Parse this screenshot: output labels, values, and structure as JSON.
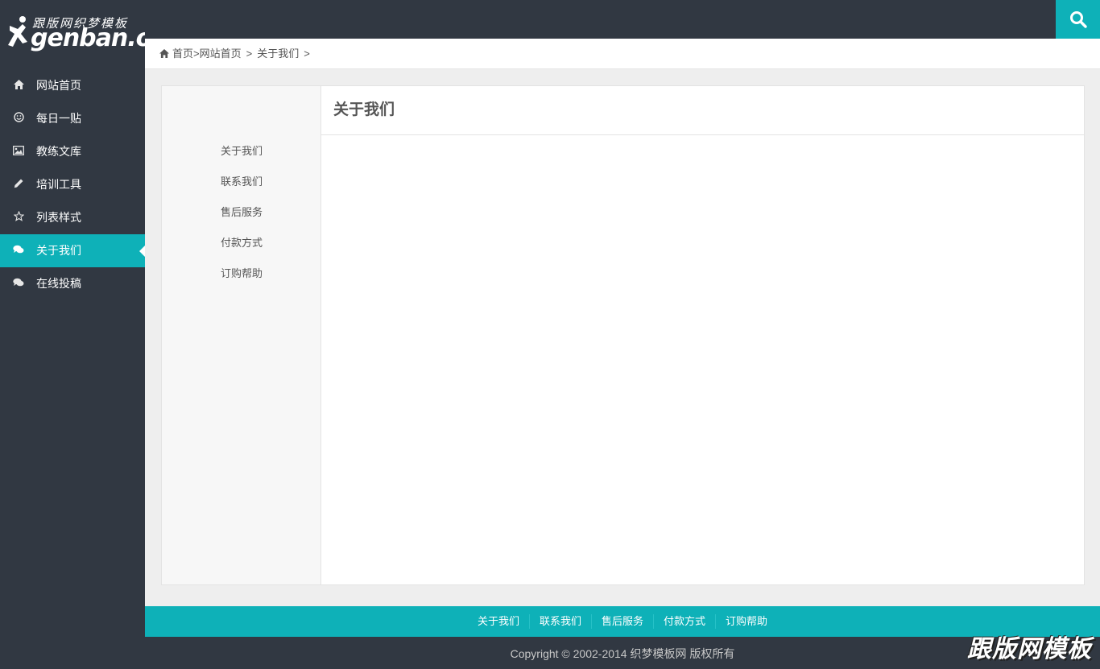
{
  "logo": {
    "zh_text": "跟版网织梦模板",
    "en_text": "genban.org"
  },
  "sidebar": {
    "items": [
      {
        "label": "网站首页",
        "icon": "home-icon",
        "active": false
      },
      {
        "label": "每日一贴",
        "icon": "smile-icon",
        "active": false
      },
      {
        "label": "教练文库",
        "icon": "image-icon",
        "active": false
      },
      {
        "label": "培训工具",
        "icon": "pencil-icon",
        "active": false
      },
      {
        "label": "列表样式",
        "icon": "star-icon",
        "active": false
      },
      {
        "label": "关于我们",
        "icon": "comments-icon",
        "active": true
      },
      {
        "label": "在线投稿",
        "icon": "comments-icon",
        "active": false
      }
    ]
  },
  "breadcrumb": {
    "home": "首页",
    "items": [
      "网站首页",
      "关于我们"
    ],
    "separator": ">"
  },
  "subnav": {
    "items": [
      "关于我们",
      "联系我们",
      "售后服务",
      "付款方式",
      "订购帮助"
    ]
  },
  "content": {
    "title": "关于我们"
  },
  "footer": {
    "links": [
      "关于我们",
      "联系我们",
      "售后服务",
      "付款方式",
      "订购帮助"
    ],
    "copyright": "Copyright © 2002-2014 织梦模板网 版权所有"
  },
  "watermark": "跟版网模板",
  "colors": {
    "accent": "#0eb1b8",
    "dark": "#313842",
    "main_bg": "#eeeeee"
  }
}
